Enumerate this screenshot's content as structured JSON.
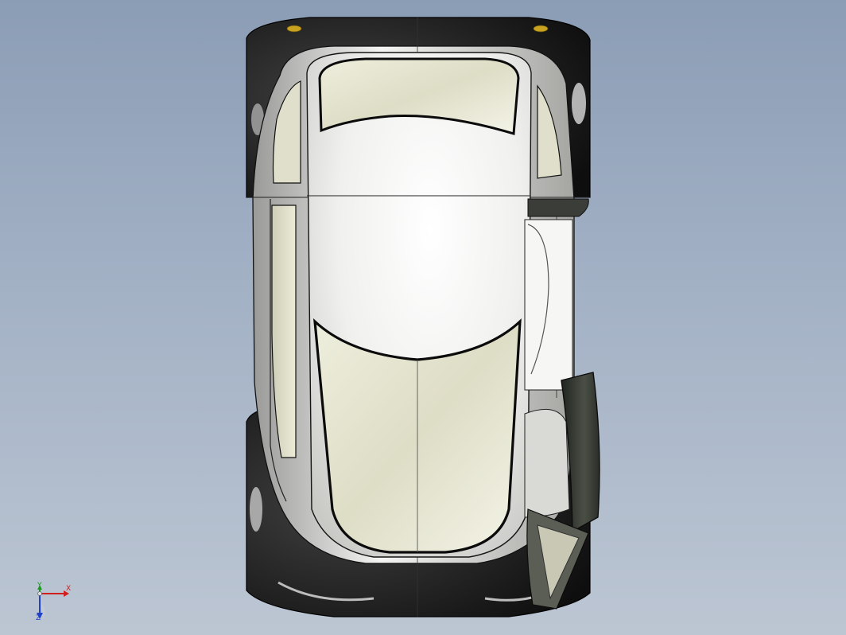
{
  "viewport": {
    "background_top": "#8b9db5",
    "background_bottom": "#bcc6d3"
  },
  "model": {
    "body_color": "#f2f2f0",
    "glass_color": "#e4e4d2",
    "tire_color": "#151515",
    "outline_color": "#0c0c0c"
  },
  "triad": {
    "x_label": "X",
    "y_label": "Y",
    "z_label": "Z",
    "x_color": "#d11f1f",
    "y_color": "#1a9a1a",
    "z_color": "#2040c8"
  }
}
